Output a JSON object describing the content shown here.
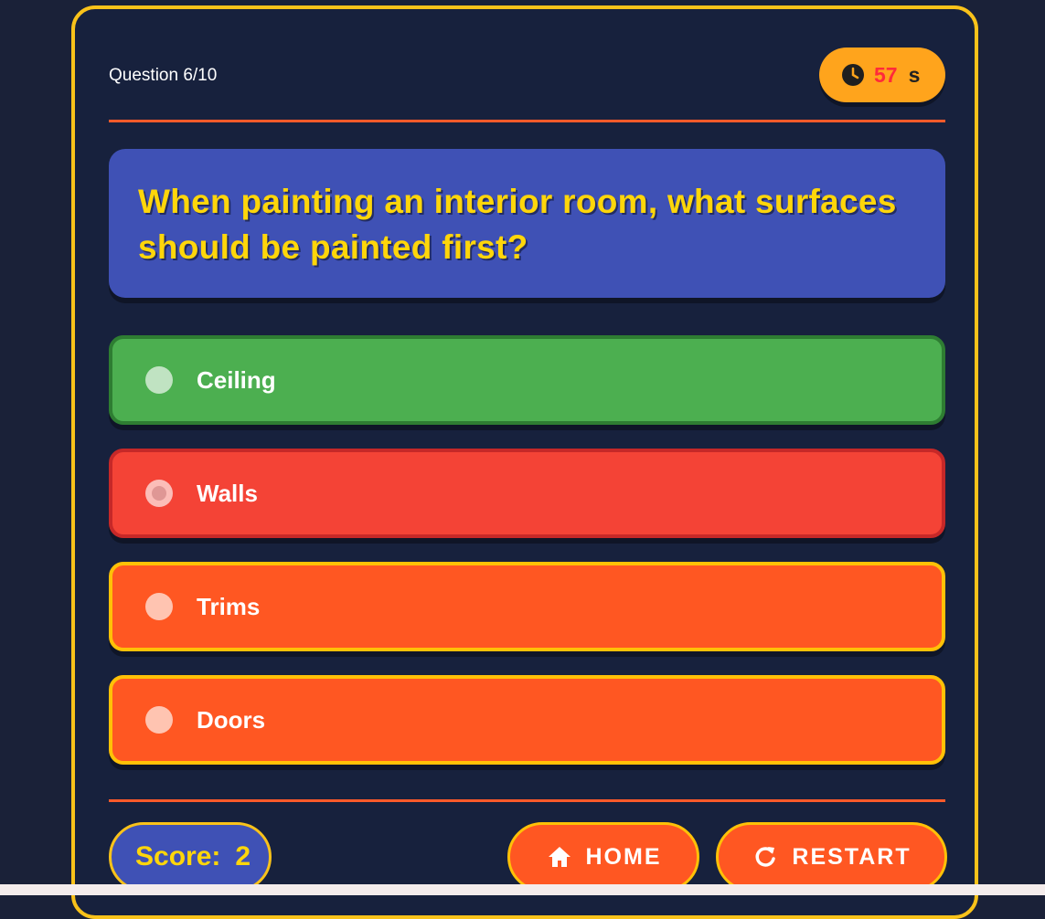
{
  "header": {
    "question_counter": "Question 6/10",
    "timer_value": "57",
    "timer_unit": "s",
    "timer_icon": "clock-icon"
  },
  "question": {
    "text": "When painting an interior room, what surfaces should be painted first?"
  },
  "options": [
    {
      "label": "Ceiling",
      "state": "correct"
    },
    {
      "label": "Walls",
      "state": "wrong"
    },
    {
      "label": "Trims",
      "state": "normal"
    },
    {
      "label": "Doors",
      "state": "normal"
    }
  ],
  "footer": {
    "score_label": "Score:",
    "score_value": "2",
    "home_label": "HOME",
    "home_icon": "home-icon",
    "restart_label": "RESTART",
    "restart_icon": "restart-icon"
  },
  "colors": {
    "background": "#1a2138",
    "card": "#17213d",
    "accent_yellow": "#f9c21a",
    "question_box": "#3f51b5",
    "question_text": "#ffd60a",
    "correct": "#4caf50",
    "wrong": "#f44336",
    "option": "#ff5722",
    "timer": "#ffa41c",
    "timer_digits": "#ff2a3a"
  }
}
